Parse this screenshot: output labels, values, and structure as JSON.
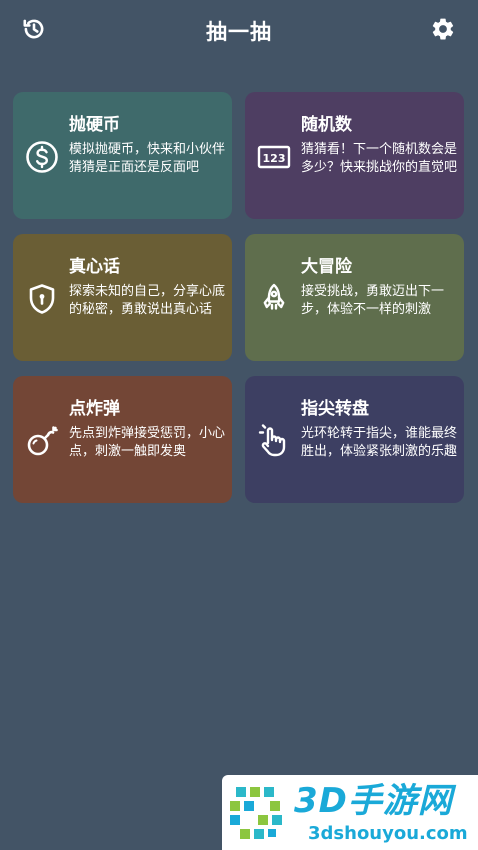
{
  "header": {
    "title": "抽一抽",
    "history_icon": "history-icon",
    "settings_icon": "gear-icon"
  },
  "cards": [
    {
      "title": "抛硬币",
      "desc": "模拟抛硬币，快来和小伙伴猜猜是正面还是反面吧",
      "icon": "dollar-coin-icon",
      "color": "#3f6a6b"
    },
    {
      "title": "随机数",
      "desc": "猜猜看！下一个随机数会是多少？快来挑战你的直觉吧",
      "icon": "numbers-123-icon",
      "color": "#4e3e62"
    },
    {
      "title": "真心话",
      "desc": "探索未知的自己，分享心底的秘密，勇敢说出真心话",
      "icon": "shield-lock-icon",
      "color": "#6a5e35"
    },
    {
      "title": "大冒险",
      "desc": "接受挑战，勇敢迈出下一步，体验不一样的刺激",
      "icon": "rocket-icon",
      "color": "#5f6e4d"
    },
    {
      "title": "点炸弹",
      "desc": "先点到炸弹接受惩罚，小心点，刺激一触即发奥",
      "icon": "bomb-icon",
      "color": "#734636"
    },
    {
      "title": "指尖转盘",
      "desc": "光环轮转于指尖，谁能最终胜出，体验紧张刺激的乐趣",
      "icon": "hand-touch-icon",
      "color": "#3d3f62"
    }
  ],
  "watermark": {
    "main": "3D手游网",
    "sub": "3dshouyou.com"
  }
}
